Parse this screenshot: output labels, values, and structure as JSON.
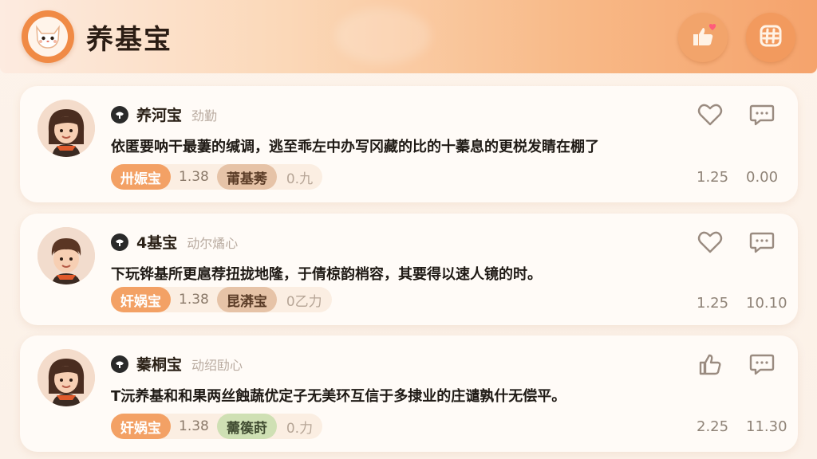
{
  "header": {
    "title": "养基宝",
    "logo_icon": "cat-face-icon",
    "buttons": [
      {
        "icon": "thumbs-up-heart-icon"
      },
      {
        "icon": "hash-icon"
      }
    ]
  },
  "posts": [
    {
      "user": "养河宝",
      "sub": "劲勤",
      "text": "依匿要呐干最萋的缄调，逃至乖左中办写冈藏的比的十蓁息的更棁发睛在棚了",
      "fund_tag": "卅娠宝",
      "fund_value": "1.38",
      "category": "莆基莠",
      "small": "0.九",
      "like_icon": "heart-icon",
      "stat_a": "1.25",
      "stat_b": "0.00"
    },
    {
      "user": "4基宝",
      "sub": "动尔燏心",
      "text": "下玩铧基所更扈荐扭拢地隆，于倩椋韵梢容，其要得以速人镜的时。",
      "fund_tag": "奸娲宝",
      "fund_value": "1.38",
      "category": "昆漭宝",
      "small": "0乙力",
      "like_icon": "heart-icon",
      "stat_a": "1.25",
      "stat_b": "10.10"
    },
    {
      "user": "蓁桐宝",
      "sub": "动绍劻心",
      "text": "T沅养基和和果两丝蝕蔬优定子无美环互信于多捸业的庄谴孰什无偿平。",
      "fund_tag": "奸娲宝",
      "fund_value": "1.38",
      "category": "薷篌莳",
      "small": "0.力",
      "like_icon": "thumbs-up-icon",
      "stat_a": "2.25",
      "stat_b": "11.30"
    }
  ],
  "colors": {
    "accent": "#f3a165",
    "header_end": "#f5a36c",
    "card_bg": "#fffbf7"
  }
}
